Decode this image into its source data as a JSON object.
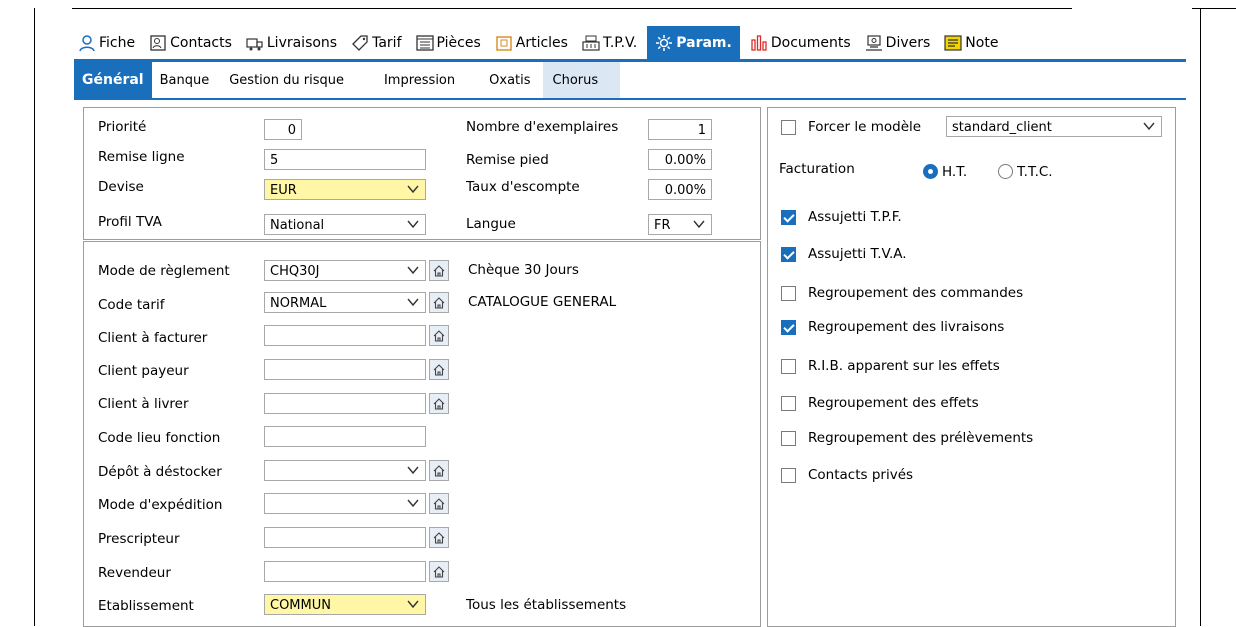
{
  "colors": {
    "accent": "#1a6fbd",
    "highlight": "#fff6a6"
  },
  "main_tabs": [
    {
      "label": "Fiche",
      "icon": "person-icon"
    },
    {
      "label": "Contacts",
      "icon": "contact-card-icon"
    },
    {
      "label": "Livraisons",
      "icon": "delivery-icon"
    },
    {
      "label": "Tarif",
      "icon": "price-tag-icon"
    },
    {
      "label": "Pièces",
      "icon": "document-list-icon"
    },
    {
      "label": "Articles",
      "icon": "articles-icon"
    },
    {
      "label": "T.P.V.",
      "icon": "cash-register-icon"
    },
    {
      "label": "Param.",
      "icon": "gear-icon"
    },
    {
      "label": "Documents",
      "icon": "bar-chart-icon"
    },
    {
      "label": "Divers",
      "icon": "misc-icon"
    },
    {
      "label": "Note",
      "icon": "note-icon"
    }
  ],
  "sub_tabs": [
    "Général",
    "Banque",
    "Gestion du risque",
    "Impression",
    "Oxatis",
    "Chorus"
  ],
  "top_panel": {
    "priorite": {
      "label": "Priorité",
      "value": "0"
    },
    "remise_ligne": {
      "label": "Remise ligne",
      "value": "5"
    },
    "devise": {
      "label": "Devise",
      "value": "EUR"
    },
    "profil_tva": {
      "label": "Profil TVA",
      "value": "National"
    },
    "nb_exemplaires": {
      "label": "Nombre d'exemplaires",
      "value": "1"
    },
    "remise_pied": {
      "label": "Remise pied",
      "value": "0.00%"
    },
    "taux_escompte": {
      "label": "Taux d'escompte",
      "value": "0.00%"
    },
    "langue": {
      "label": "Langue",
      "value": "FR"
    }
  },
  "bottom_panel": {
    "mode_reglement": {
      "label": "Mode de règlement",
      "value": "CHQ30J",
      "desc": "Chèque 30 Jours"
    },
    "code_tarif": {
      "label": "Code tarif",
      "value": "NORMAL",
      "desc": "CATALOGUE GENERAL"
    },
    "client_facturer": {
      "label": "Client à facturer",
      "value": ""
    },
    "client_payeur": {
      "label": "Client payeur",
      "value": ""
    },
    "client_livrer": {
      "label": "Client à livrer",
      "value": ""
    },
    "code_lieu": {
      "label": "Code lieu fonction",
      "value": ""
    },
    "depot": {
      "label": "Dépôt à déstocker",
      "value": ""
    },
    "mode_expedition": {
      "label": "Mode d'expédition",
      "value": ""
    },
    "prescripteur": {
      "label": "Prescripteur",
      "value": ""
    },
    "revendeur": {
      "label": "Revendeur",
      "value": ""
    },
    "etablissement": {
      "label": "Etablissement",
      "value": "COMMUN",
      "desc": "Tous les établissements"
    }
  },
  "right_panel": {
    "forcer_modele": {
      "label": "Forcer le modèle",
      "checked": false,
      "value": "standard_client"
    },
    "facturation": {
      "label": "Facturation",
      "options": [
        "H.T.",
        "T.T.C."
      ],
      "selected": "H.T."
    },
    "checks": [
      {
        "label": "Assujetti T.P.F.",
        "checked": true
      },
      {
        "label": "Assujetti T.V.A.",
        "checked": true
      },
      {
        "label": "Regroupement des commandes",
        "checked": false
      },
      {
        "label": "Regroupement des livraisons",
        "checked": true
      },
      {
        "label": "R.I.B. apparent sur les effets",
        "checked": false
      },
      {
        "label": "Regroupement des effets",
        "checked": false
      },
      {
        "label": "Regroupement des prélèvements",
        "checked": false
      },
      {
        "label": "Contacts privés",
        "checked": false
      }
    ]
  }
}
